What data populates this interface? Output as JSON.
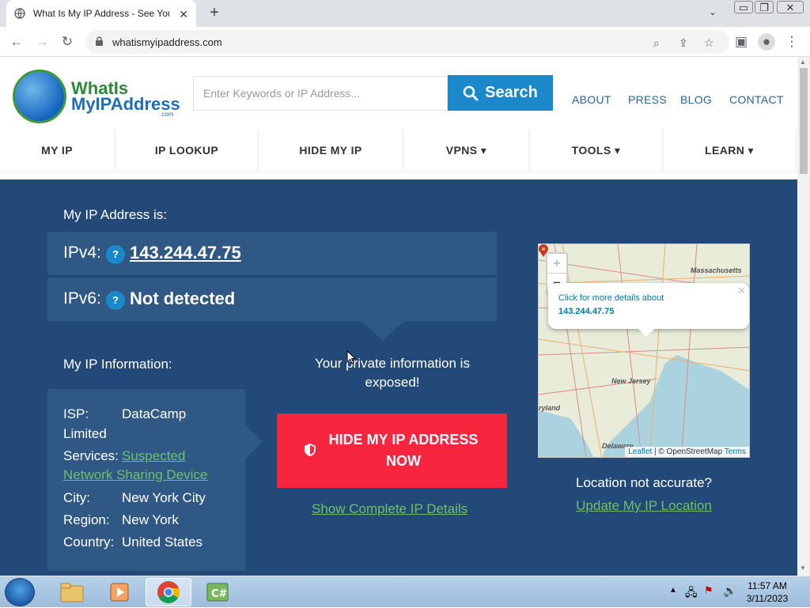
{
  "browser": {
    "tab_title": "What Is My IP Address - See You",
    "url": "whatismyipaddress.com"
  },
  "header": {
    "logo_line1": "WhatIs",
    "logo_line2": "MyIPAddress",
    "logo_com": ".com",
    "search_placeholder": "Enter Keywords or IP Address...",
    "search_label": "Search",
    "links": [
      "ABOUT",
      "PRESS",
      "BLOG",
      "CONTACT"
    ]
  },
  "nav": {
    "items": [
      "MY IP",
      "IP LOOKUP",
      "HIDE MY IP",
      "VPNS ▾",
      "TOOLS ▾",
      "LEARN ▾"
    ]
  },
  "hero": {
    "my_ip_label": "My IP Address is:",
    "ipv4_label": "IPv4:",
    "ipv4_value": "143.244.47.75",
    "ipv6_label": "IPv6:",
    "ipv6_value": "Not detected",
    "help_glyph": "?",
    "info_label": "My IP Information:",
    "isp_key": "ISP:",
    "isp_value": "DataCamp",
    "isp_value2": "Limited",
    "services_key": "Services:",
    "services_value1": "Suspected",
    "services_value2": "Network Sharing Device",
    "city_key": "City:",
    "city_value": "New York City",
    "region_key": "Region:",
    "region_value": "New York",
    "country_key": "Country:",
    "country_value": "United States",
    "exposed_text": "Your private information is exposed!",
    "hide_button_line1": "HIDE MY IP ADDRESS",
    "hide_button_line2": "NOW",
    "show_details": "Show Complete IP Details",
    "location_question": "Location not accurate?",
    "update_location": "Update My IP Location"
  },
  "map": {
    "popup_line1": "Click for more details about",
    "popup_line2": "143.244.47.75",
    "label_massachusetts": "Massachusetts",
    "label_new_jersey": "New Jersey",
    "label_yland": "ryland",
    "label_delaware": "Delaware",
    "attrib_leaflet": "Leaflet",
    "attrib_osm": "| © OpenStreetMap",
    "attrib_terms": "Terms",
    "zoom_in": "+",
    "zoom_out": "−"
  },
  "taskbar": {
    "time": "11:57 AM",
    "date": "3/11/2023"
  },
  "colors": {
    "hero_bg": "#224977",
    "box_bg": "#2f5885",
    "accent_blue": "#1a88c9",
    "cta_red": "#f7263e",
    "link_green": "#6ec16a"
  }
}
